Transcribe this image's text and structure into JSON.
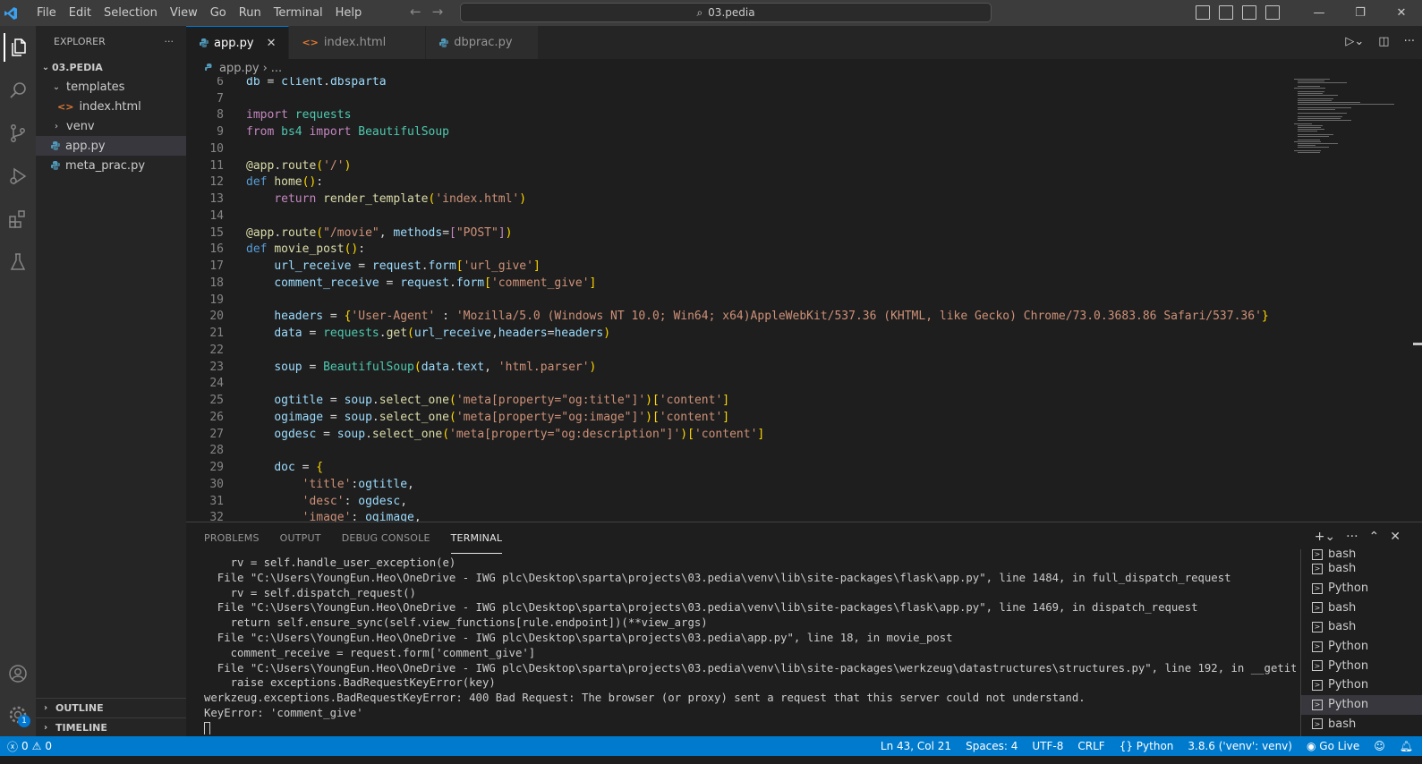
{
  "menu": [
    "File",
    "Edit",
    "Selection",
    "View",
    "Go",
    "Run",
    "Terminal",
    "Help"
  ],
  "search": {
    "text": "03.pedia"
  },
  "sidebar": {
    "title": "EXPLORER",
    "more": "···",
    "root": "03.PEDIA",
    "items": [
      {
        "label": "templates",
        "type": "folder-open",
        "level": 1
      },
      {
        "label": "index.html",
        "type": "html",
        "level": 2
      },
      {
        "label": "venv",
        "type": "folder",
        "level": 1
      },
      {
        "label": "app.py",
        "type": "python",
        "level": 1,
        "selected": true
      },
      {
        "label": "meta_prac.py",
        "type": "python",
        "level": 1
      }
    ],
    "outline": "OUTLINE",
    "timeline": "TIMELINE"
  },
  "tabs": [
    {
      "label": "app.py",
      "type": "python",
      "active": true
    },
    {
      "label": "index.html",
      "type": "html",
      "active": false
    },
    {
      "label": "dbprac.py",
      "type": "python",
      "active": false
    }
  ],
  "breadcrumb": {
    "file": "app.py",
    "rest": "..."
  },
  "code": [
    {
      "n": "6",
      "html": "<span class=\"vr\">db</span> = <span class=\"vr\">client</span>.<span class=\"vr\">dbsparta</span>"
    },
    {
      "n": "7",
      "html": ""
    },
    {
      "n": "8",
      "html": "<span class=\"kw\">import</span> <span class=\"cl\">requests</span>"
    },
    {
      "n": "9",
      "html": "<span class=\"kw\">from</span> <span class=\"cl\">bs4</span> <span class=\"kw\">import</span> <span class=\"cl\">BeautifulSoup</span>"
    },
    {
      "n": "10",
      "html": ""
    },
    {
      "n": "11",
      "html": "<span class=\"fn\">@app</span>.<span class=\"fn\">route</span><span class=\"pn\">(</span><span class=\"st\">'/'</span><span class=\"pn\">)</span>"
    },
    {
      "n": "12",
      "html": "<span class=\"kb\">def</span> <span class=\"fn\">home</span><span class=\"pn\">()</span>:"
    },
    {
      "n": "13",
      "html": "    <span class=\"kw\">return</span> <span class=\"fn\">render_template</span><span class=\"pn\">(</span><span class=\"st\">'index.html'</span><span class=\"pn\">)</span>"
    },
    {
      "n": "14",
      "html": ""
    },
    {
      "n": "15",
      "html": "<span class=\"fn\">@app</span>.<span class=\"fn\">route</span><span class=\"pn\">(</span><span class=\"st\">\"/movie\"</span>, <span class=\"vr\">methods</span>=<span class=\"kw\">[</span><span class=\"st\">\"POST\"</span><span class=\"kw\">]</span><span class=\"pn\">)</span>"
    },
    {
      "n": "16",
      "html": "<span class=\"kb\">def</span> <span class=\"fn\">movie_post</span><span class=\"pn\">()</span>:"
    },
    {
      "n": "17",
      "html": "    <span class=\"vr\">url_receive</span> = <span class=\"vr\">request</span>.<span class=\"vr\">form</span><span class=\"pn\">[</span><span class=\"st\">'url_give'</span><span class=\"pn\">]</span>"
    },
    {
      "n": "18",
      "html": "    <span class=\"vr\">comment_receive</span> = <span class=\"vr\">request</span>.<span class=\"vr\">form</span><span class=\"pn\">[</span><span class=\"st\">'comment_give'</span><span class=\"pn\">]</span>"
    },
    {
      "n": "19",
      "html": ""
    },
    {
      "n": "20",
      "html": "    <span class=\"vr\">headers</span> = <span class=\"pn\">{</span><span class=\"st\">'User-Agent'</span> : <span class=\"st\">'Mozilla/5.0 (Windows NT 10.0; Win64; x64)AppleWebKit/537.36 (KHTML, like Gecko) Chrome/73.0.3683.86 Safari/537.36'</span><span class=\"pn\">}</span>"
    },
    {
      "n": "21",
      "html": "    <span class=\"vr\">data</span> = <span class=\"cl\">requests</span>.<span class=\"fn\">get</span><span class=\"pn\">(</span><span class=\"vr\">url_receive</span>,<span class=\"vr\">headers</span>=<span class=\"vr\">headers</span><span class=\"pn\">)</span>"
    },
    {
      "n": "22",
      "html": ""
    },
    {
      "n": "23",
      "html": "    <span class=\"vr\">soup</span> = <span class=\"cl\">BeautifulSoup</span><span class=\"pn\">(</span><span class=\"vr\">data</span>.<span class=\"vr\">text</span>, <span class=\"st\">'html.parser'</span><span class=\"pn\">)</span>"
    },
    {
      "n": "24",
      "html": ""
    },
    {
      "n": "25",
      "html": "    <span class=\"vr\">ogtitle</span> = <span class=\"vr\">soup</span>.<span class=\"fn\">select_one</span><span class=\"pn\">(</span><span class=\"st\">'meta[property=\"og:title\"]'</span><span class=\"pn\">)</span><span class=\"pn\">[</span><span class=\"st\">'content'</span><span class=\"pn\">]</span>"
    },
    {
      "n": "26",
      "html": "    <span class=\"vr\">ogimage</span> = <span class=\"vr\">soup</span>.<span class=\"fn\">select_one</span><span class=\"pn\">(</span><span class=\"st\">'meta[property=\"og:image\"]'</span><span class=\"pn\">)</span><span class=\"pn\">[</span><span class=\"st\">'content'</span><span class=\"pn\">]</span>"
    },
    {
      "n": "27",
      "html": "    <span class=\"vr\">ogdesc</span> = <span class=\"vr\">soup</span>.<span class=\"fn\">select_one</span><span class=\"pn\">(</span><span class=\"st\">'meta[property=\"og:description\"]'</span><span class=\"pn\">)</span><span class=\"pn\">[</span><span class=\"st\">'content'</span><span class=\"pn\">]</span>"
    },
    {
      "n": "28",
      "html": ""
    },
    {
      "n": "29",
      "html": "    <span class=\"vr\">doc</span> = <span class=\"pn\">{</span>"
    },
    {
      "n": "30",
      "html": "        <span class=\"st\">'title'</span>:<span class=\"vr\">ogtitle</span>,"
    },
    {
      "n": "31",
      "html": "        <span class=\"st\">'desc'</span>: <span class=\"vr\">ogdesc</span>,"
    },
    {
      "n": "32",
      "html": "        <span class=\"st\">'image'</span>: <span class=\"vr\">ogimage</span>,"
    }
  ],
  "panel": {
    "tabs": [
      "PROBLEMS",
      "OUTPUT",
      "DEBUG CONSOLE",
      "TERMINAL"
    ],
    "active_tab": "TERMINAL",
    "terminal_lines": [
      "    rv = self.handle_user_exception(e)",
      "  File \"C:\\Users\\YoungEun.Heo\\OneDrive - IWG plc\\Desktop\\sparta\\projects\\03.pedia\\venv\\lib\\site-packages\\flask\\app.py\", line 1484, in full_dispatch_request",
      "    rv = self.dispatch_request()",
      "  File \"C:\\Users\\YoungEun.Heo\\OneDrive - IWG plc\\Desktop\\sparta\\projects\\03.pedia\\venv\\lib\\site-packages\\flask\\app.py\", line 1469, in dispatch_request",
      "    return self.ensure_sync(self.view_functions[rule.endpoint])(**view_args)",
      "  File \"c:\\Users\\YoungEun.Heo\\OneDrive - IWG plc\\Desktop\\sparta\\projects\\03.pedia\\app.py\", line 18, in movie_post",
      "    comment_receive = request.form['comment_give']",
      "  File \"C:\\Users\\YoungEun.Heo\\OneDrive - IWG plc\\Desktop\\sparta\\projects\\03.pedia\\venv\\lib\\site-packages\\werkzeug\\datastructures\\structures.py\", line 192, in __getitem__",
      "    raise exceptions.BadRequestKeyError(key)",
      "werkzeug.exceptions.BadRequestKeyError: 400 Bad Request: The browser (or proxy) sent a request that this server could not understand.",
      "KeyError: 'comment_give'"
    ],
    "terminals": [
      "bash",
      "bash",
      "Python",
      "bash",
      "bash",
      "Python",
      "Python",
      "Python",
      "Python",
      "bash"
    ],
    "selected_terminal": 8
  },
  "status": {
    "errors": "0",
    "warnings": "0",
    "position": "Ln 43, Col 21",
    "spaces": "Spaces: 4",
    "encoding": "UTF-8",
    "eol": "CRLF",
    "language": "Python",
    "interpreter": "3.8.6 ('venv': venv)",
    "golive": "Go Live"
  },
  "colors": {
    "accent": "#007acc",
    "background": "#1e1e1e",
    "sidebar": "#252526",
    "activitybar": "#333333"
  }
}
